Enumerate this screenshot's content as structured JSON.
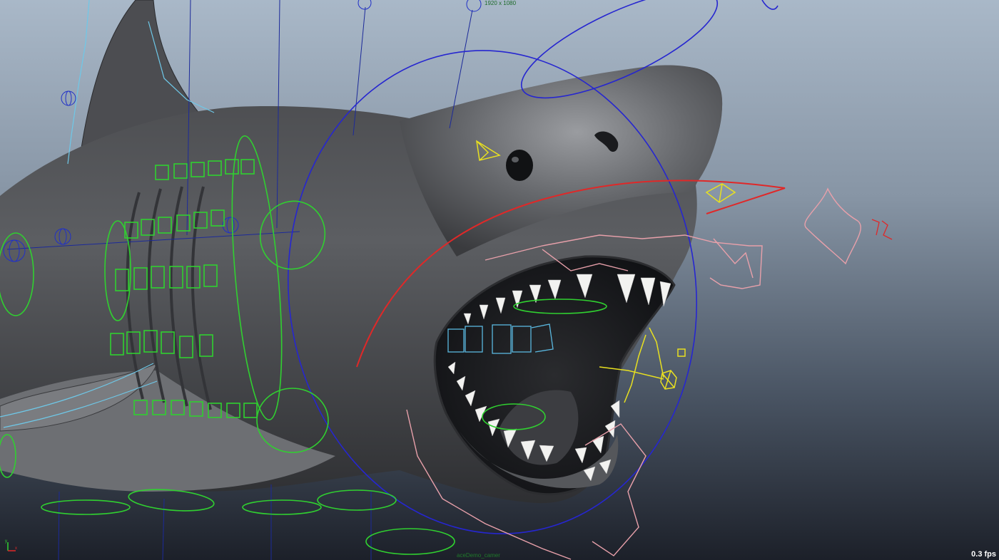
{
  "viewport": {
    "resolution_gate": "1920 x 1080",
    "camera_name": "aceDemo_camer",
    "fps_display": "0.3 fps",
    "axis_labels": {
      "y": "y",
      "x": "x"
    }
  },
  "colors": {
    "background_top": "#a9b8c8",
    "background_bottom": "#1c2029",
    "shark_skin": "#5a5c60",
    "green_controls": "#2fd22f",
    "blue_controls": "#2020c8",
    "pink_controls": "#e4a0a8",
    "red_curve": "#e02020",
    "yellow_locators": "#e8e020",
    "cyan_controls": "#70c8e8",
    "fps_text": "#ffffff"
  }
}
